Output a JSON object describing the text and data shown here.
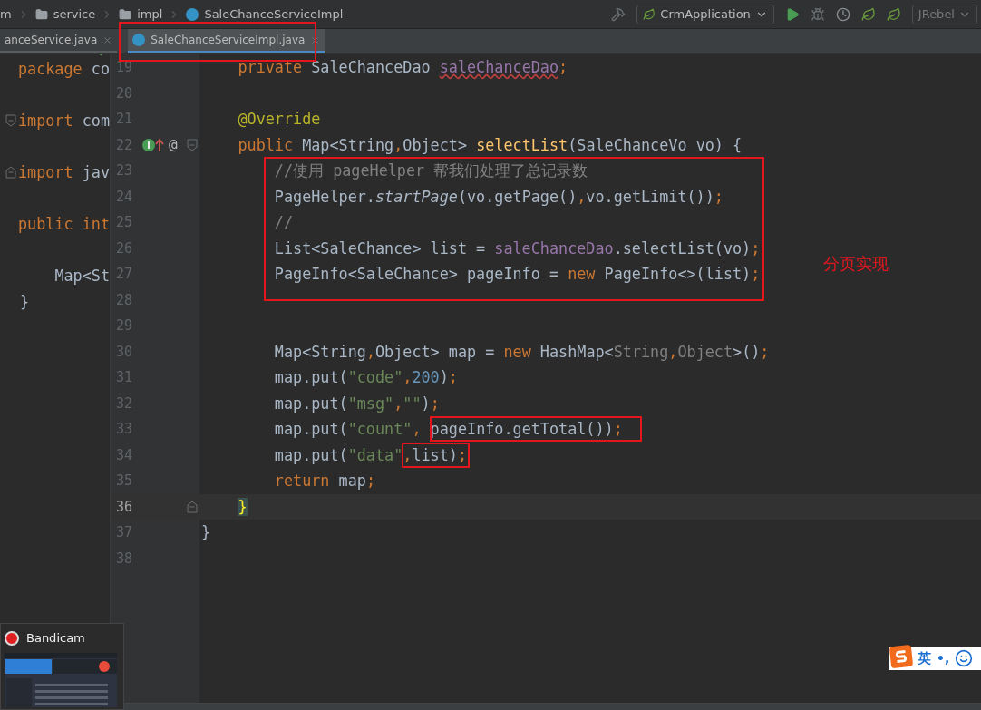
{
  "breadcrumbs": [
    {
      "label": "m",
      "kind": "text"
    },
    {
      "label": "service",
      "kind": "folder"
    },
    {
      "label": "impl",
      "kind": "folder"
    },
    {
      "label": "SaleChanceServiceImpl",
      "kind": "class"
    }
  ],
  "toolbar": {
    "run_config": "CrmApplication",
    "plugin": "JRebel"
  },
  "tabs": [
    {
      "label": "anceService.java",
      "selected": false
    },
    {
      "label": "SaleChanceServiceImpl.java",
      "selected": true
    }
  ],
  "left_pane": {
    "lines": [
      {
        "kind": "plain",
        "tokens": [
          {
            "kind": "kw",
            "t": "package "
          },
          {
            "kind": "plain",
            "t": "co"
          }
        ]
      },
      {
        "kind": "plain"
      },
      {
        "kind": "fold_open",
        "tokens": [
          {
            "kind": "kw",
            "t": "import "
          },
          {
            "kind": "plain",
            "t": "com"
          }
        ]
      },
      {
        "kind": "plain"
      },
      {
        "kind": "fold_close",
        "tokens": [
          {
            "kind": "kw",
            "t": "import "
          },
          {
            "kind": "plain",
            "t": "jav"
          }
        ]
      },
      {
        "kind": "plain"
      },
      {
        "kind": "plain",
        "tokens": [
          {
            "kind": "kw",
            "t": "public "
          },
          {
            "kind": "kw",
            "t": "int"
          }
        ]
      },
      {
        "kind": "plain"
      },
      {
        "kind": "plain",
        "tokens": [
          {
            "kind": "plain",
            "t": "    Map<St"
          }
        ]
      },
      {
        "kind": "plain",
        "tokens": [
          {
            "kind": "plain",
            "t": "}"
          }
        ]
      }
    ]
  },
  "editor": {
    "lines": [
      {
        "number": "19",
        "current": false,
        "kind": "plain",
        "tokens": [
          {
            "kind": "kw",
            "t": "    private "
          },
          {
            "kind": "plain",
            "t": "SaleChanceDao "
          },
          {
            "kind": "field_warn",
            "t": "saleChanceDao"
          },
          {
            "kind": "kw",
            "t": ";"
          }
        ]
      },
      {
        "number": "20",
        "current": false,
        "kind": "plain"
      },
      {
        "number": "21",
        "current": false,
        "kind": "plain",
        "tokens": [
          {
            "kind": "annotation",
            "t": "    @Override"
          }
        ]
      },
      {
        "number": "22",
        "current": false,
        "kind": "fold_open",
        "marker": "@",
        "tokens": [
          {
            "kind": "kw",
            "t": "    public "
          },
          {
            "kind": "plain",
            "t": "Map<String"
          },
          {
            "kind": "kw",
            "t": ","
          },
          {
            "kind": "plain",
            "t": "Object> "
          },
          {
            "kind": "fn",
            "t": "selectList"
          },
          {
            "kind": "plain",
            "t": "(SaleChanceVo vo) {"
          }
        ]
      },
      {
        "number": "23",
        "current": false,
        "kind": "plain",
        "tokens": [
          {
            "kind": "comment",
            "t": "        //使用 pageHelper 帮我们处理了总记录数"
          }
        ]
      },
      {
        "number": "24",
        "current": false,
        "kind": "plain",
        "tokens": [
          {
            "kind": "plain",
            "t": "        PageHelper."
          },
          {
            "kind": "static",
            "t": "startPage"
          },
          {
            "kind": "plain",
            "t": "(vo.getPage()"
          },
          {
            "kind": "kw",
            "t": ","
          },
          {
            "kind": "plain",
            "t": "vo.getLimit())"
          },
          {
            "kind": "kw",
            "t": ";"
          }
        ]
      },
      {
        "number": "25",
        "current": false,
        "kind": "plain",
        "tokens": [
          {
            "kind": "comment",
            "t": "        //"
          }
        ]
      },
      {
        "number": "26",
        "current": false,
        "kind": "plain",
        "tokens": [
          {
            "kind": "plain",
            "t": "        List<SaleChance> list = "
          },
          {
            "kind": "field",
            "t": "saleChanceDao"
          },
          {
            "kind": "plain",
            "t": ".selectList(vo)"
          },
          {
            "kind": "kw",
            "t": ";"
          }
        ]
      },
      {
        "number": "27",
        "current": false,
        "kind": "plain",
        "tokens": [
          {
            "kind": "plain",
            "t": "        PageInfo<SaleChance> pageInfo = "
          },
          {
            "kind": "kw",
            "t": "new "
          },
          {
            "kind": "plain",
            "t": "PageInfo<>(list)"
          },
          {
            "kind": "kw",
            "t": ";"
          }
        ]
      },
      {
        "number": "28",
        "current": false,
        "kind": "plain"
      },
      {
        "number": "29",
        "current": false,
        "kind": "plain"
      },
      {
        "number": "30",
        "current": false,
        "kind": "plain",
        "tokens": [
          {
            "kind": "plain",
            "t": "        Map<String"
          },
          {
            "kind": "kw",
            "t": ","
          },
          {
            "kind": "plain",
            "t": "Object> map = "
          },
          {
            "kind": "kw",
            "t": "new "
          },
          {
            "kind": "plain",
            "t": "HashMap<"
          },
          {
            "kind": "dim",
            "t": "String"
          },
          {
            "kind": "kw",
            "t": ","
          },
          {
            "kind": "dim",
            "t": "Object"
          },
          {
            "kind": "plain",
            "t": ">()"
          },
          {
            "kind": "kw",
            "t": ";"
          }
        ]
      },
      {
        "number": "31",
        "current": false,
        "kind": "plain",
        "tokens": [
          {
            "kind": "plain",
            "t": "        map.put("
          },
          {
            "kind": "str",
            "t": "\"code\""
          },
          {
            "kind": "kw",
            "t": ","
          },
          {
            "kind": "num",
            "t": "200"
          },
          {
            "kind": "plain",
            "t": ")"
          },
          {
            "kind": "kw",
            "t": ";"
          }
        ]
      },
      {
        "number": "32",
        "current": false,
        "kind": "plain",
        "tokens": [
          {
            "kind": "plain",
            "t": "        map.put("
          },
          {
            "kind": "str",
            "t": "\"msg\""
          },
          {
            "kind": "kw",
            "t": ","
          },
          {
            "kind": "str",
            "t": "\"\""
          },
          {
            "kind": "plain",
            "t": ")"
          },
          {
            "kind": "kw",
            "t": ";"
          }
        ]
      },
      {
        "number": "33",
        "current": false,
        "kind": "plain",
        "tokens": [
          {
            "kind": "plain",
            "t": "        map.put("
          },
          {
            "kind": "str",
            "t": "\"count\""
          },
          {
            "kind": "kw",
            "t": ", "
          },
          {
            "kind": "plain",
            "t": "pageInfo.getTotal())",
            "framed": true
          },
          {
            "kind": "kw",
            "t": ";",
            "framed": true
          }
        ]
      },
      {
        "number": "34",
        "current": false,
        "kind": "plain",
        "tokens": [
          {
            "kind": "plain",
            "t": "        map.put("
          },
          {
            "kind": "str",
            "t": "\"data\""
          },
          {
            "kind": "kw",
            "t": ",",
            "framed": true
          },
          {
            "kind": "plain",
            "t": "list)",
            "framed": true
          },
          {
            "kind": "kw",
            "t": ";",
            "framed": true
          }
        ]
      },
      {
        "number": "35",
        "current": false,
        "kind": "plain",
        "tokens": [
          {
            "kind": "kw",
            "t": "        return "
          },
          {
            "kind": "plain",
            "t": "map"
          },
          {
            "kind": "kw",
            "t": ";"
          }
        ]
      },
      {
        "number": "36",
        "current": true,
        "kind": "fold_close",
        "tokens": [
          {
            "kind": "brace",
            "t": "    }"
          }
        ]
      },
      {
        "number": "37",
        "current": false,
        "kind": "plain",
        "tokens": [
          {
            "kind": "plain",
            "t": "}"
          }
        ]
      },
      {
        "number": "38",
        "current": false,
        "kind": "plain"
      }
    ]
  },
  "markup": {
    "tab_frame": true,
    "block_frame": true,
    "note": "分页实现"
  },
  "recorder": {
    "title": "Bandicam"
  },
  "ime": {
    "mode": "英",
    "punct": "•,"
  }
}
